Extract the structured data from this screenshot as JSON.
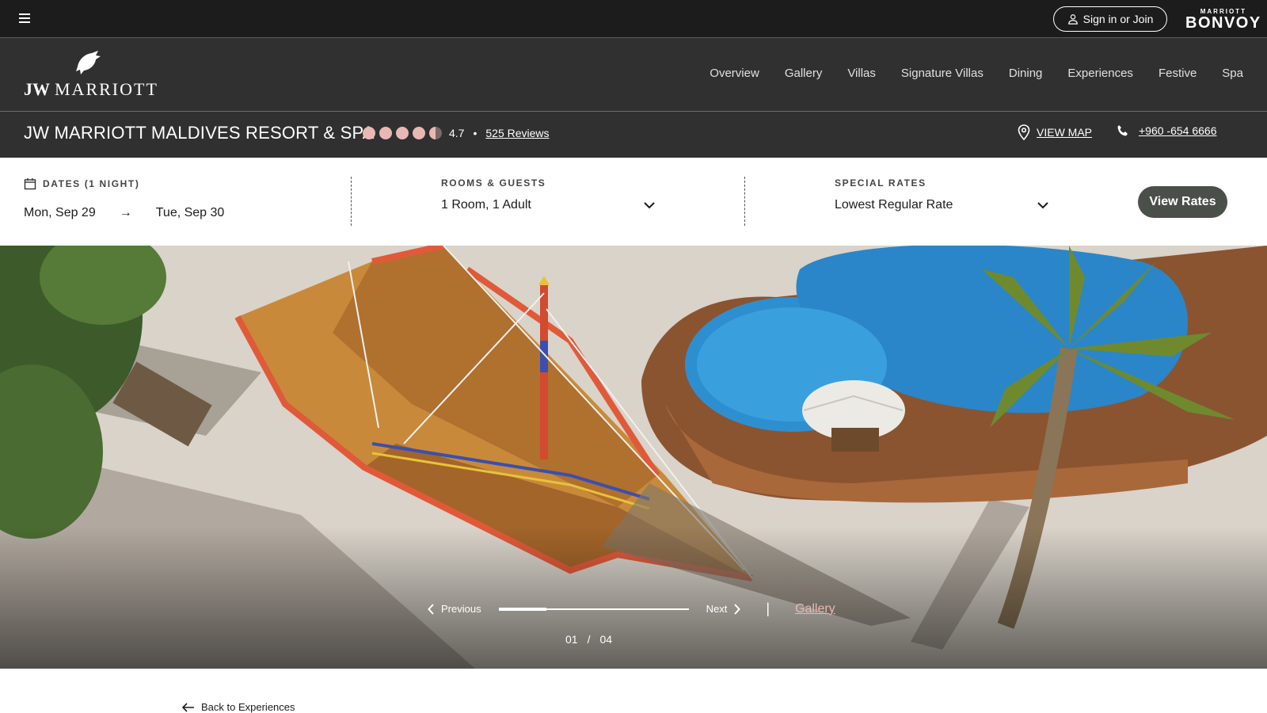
{
  "topbar": {
    "sign_in_label": "Sign in or Join",
    "brand_small": "MARRIOTT",
    "brand_big": "BONVOY"
  },
  "nav": {
    "logo_jw": "JW",
    "logo_marriott": "MARRIOTT",
    "links": [
      "Overview",
      "Gallery",
      "Villas",
      "Signature Villas",
      "Dining",
      "Experiences",
      "Festive",
      "Spa"
    ]
  },
  "hotel": {
    "name": "JW MARRIOTT MALDIVES RESORT & SPA",
    "rating_value": "4.7",
    "rating_numeric": 4.7,
    "rating_separator": "•",
    "reviews_label": "525 Reviews",
    "view_map_label": "VIEW MAP",
    "phone": "+960 -654 6666"
  },
  "booking": {
    "dates_label": "DATES (1 NIGHT)",
    "check_in": "Mon, Sep 29",
    "date_arrow": "→",
    "check_out": "Tue, Sep 30",
    "rooms_label": "ROOMS & GUESTS",
    "rooms_value": "1 Room, 1 Adult",
    "rates_label": "SPECIAL RATES",
    "rates_value": "Lowest Regular Rate",
    "view_rates_label": "View Rates"
  },
  "hero": {
    "previous_label": "Previous",
    "next_label": "Next",
    "divider": "|",
    "gallery_label": "Gallery",
    "current_slide": "01",
    "counter_separator": "/",
    "total_slides": "04",
    "progress_fraction": 0.25
  },
  "footer": {
    "back_label": "Back to Experiences"
  },
  "colors": {
    "dark_bar": "#1c1c1c",
    "nav_bg": "#303030",
    "rating_dot": "#e8b9b4",
    "view_rates_bg": "#4a4f4a",
    "gallery_link": "#e8b9b4"
  }
}
